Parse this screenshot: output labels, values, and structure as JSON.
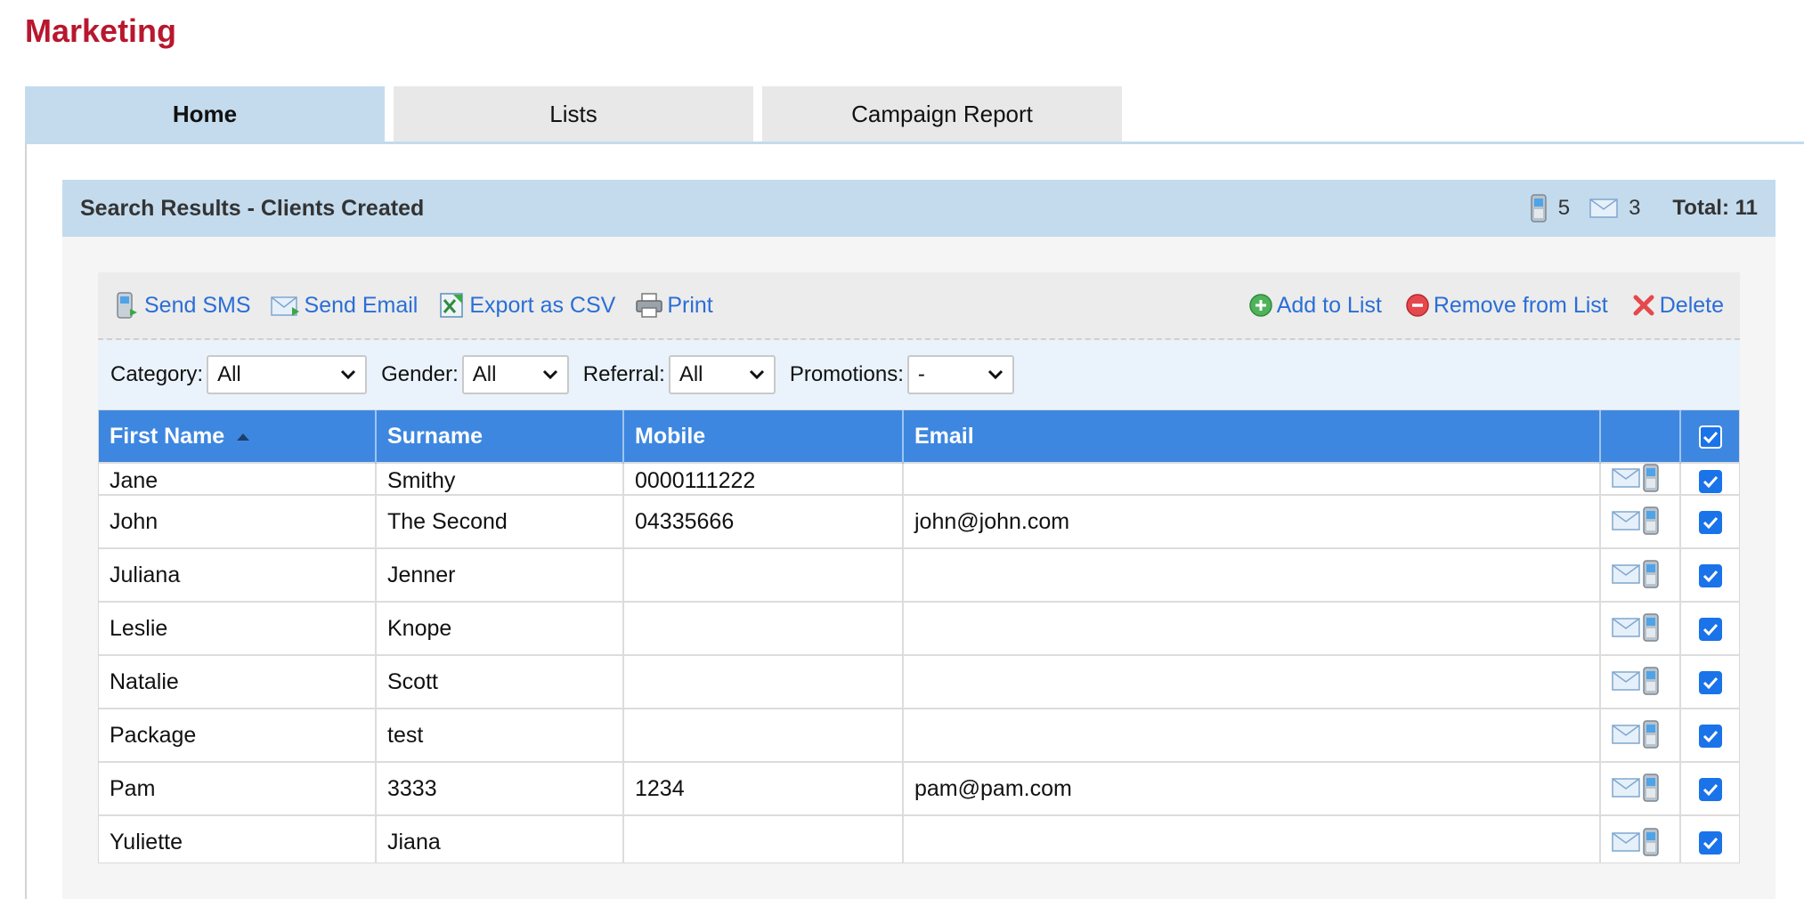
{
  "page": {
    "title": "Marketing"
  },
  "tabs": [
    {
      "label": "Home",
      "active": true
    },
    {
      "label": "Lists",
      "active": false
    },
    {
      "label": "Campaign Report",
      "active": false
    }
  ],
  "panel": {
    "title": "Search Results - Clients Created",
    "sms_count": "5",
    "email_count": "3",
    "total": "Total: 11"
  },
  "toolbar": {
    "send_sms": "Send SMS",
    "send_email": "Send Email",
    "export_csv": "Export as CSV",
    "print": "Print",
    "add_to_list": "Add to List",
    "remove_from_list": "Remove from List",
    "delete": "Delete"
  },
  "filters": {
    "category": {
      "label": "Category:",
      "value": "All"
    },
    "gender": {
      "label": "Gender:",
      "value": "All"
    },
    "referral": {
      "label": "Referral:",
      "value": "All"
    },
    "promotions": {
      "label": "Promotions:",
      "value": "-"
    }
  },
  "table": {
    "columns": [
      "First Name",
      "Surname",
      "Mobile",
      "Email"
    ],
    "rows": [
      {
        "first": "Jane",
        "surname": "Smithy",
        "mobile": "0000111222",
        "email": "",
        "checked": true
      },
      {
        "first": "John",
        "surname": "The Second",
        "mobile": "04335666",
        "email": "john@john.com",
        "checked": true
      },
      {
        "first": "Juliana",
        "surname": "Jenner",
        "mobile": "",
        "email": "",
        "checked": true
      },
      {
        "first": "Leslie",
        "surname": "Knope",
        "mobile": "",
        "email": "",
        "checked": true
      },
      {
        "first": "Natalie",
        "surname": "Scott",
        "mobile": "",
        "email": "",
        "checked": true
      },
      {
        "first": "Package",
        "surname": "test",
        "mobile": "",
        "email": "",
        "checked": true
      },
      {
        "first": "Pam",
        "surname": "3333",
        "mobile": "1234",
        "email": "pam@pam.com",
        "checked": true
      },
      {
        "first": "Yuliette",
        "surname": "Jiana",
        "mobile": "",
        "email": "",
        "checked": true
      }
    ]
  },
  "colors": {
    "brand_red": "#b8172e",
    "tab_active": "#c3dbed",
    "table_header": "#3e87e0",
    "link_blue": "#2a6ed6",
    "checkbox_blue": "#1a73e8"
  },
  "icons": {
    "sms": "phone-icon",
    "email": "envelope-icon",
    "csv": "spreadsheet-icon",
    "print": "printer-icon",
    "add": "plus-circle-icon",
    "remove": "minus-circle-icon",
    "delete": "x-icon",
    "sort": "sort-asc-icon",
    "dropdown": "chevron-down-icon",
    "check": "checkmark-icon"
  }
}
